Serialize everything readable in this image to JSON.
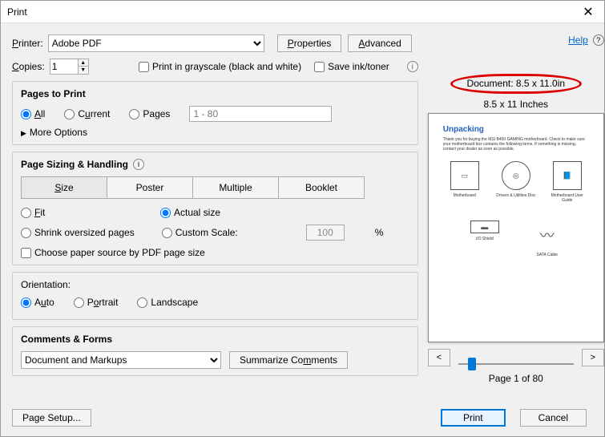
{
  "window": {
    "title": "Print"
  },
  "help": {
    "label": "Help"
  },
  "printer": {
    "label": "Printer:",
    "value": "Adobe PDF",
    "properties_btn": "Properties",
    "advanced_btn": "Advanced"
  },
  "copies": {
    "label": "Copies:",
    "value": "1"
  },
  "options": {
    "grayscale": "Print in grayscale (black and white)",
    "saveink": "Save ink/toner"
  },
  "pages": {
    "title": "Pages to Print",
    "all": "All",
    "current": "Current",
    "pages": "Pages",
    "range_placeholder": "1 - 80",
    "more": "More Options"
  },
  "handling": {
    "title": "Page Sizing & Handling",
    "tabs": {
      "size": "Size",
      "poster": "Poster",
      "multiple": "Multiple",
      "booklet": "Booklet"
    },
    "fit": "Fit",
    "actual": "Actual size",
    "shrink": "Shrink oversized pages",
    "custom": "Custom Scale:",
    "pct": "100",
    "pct_suffix": "%",
    "choose_paper": "Choose paper source by PDF page size"
  },
  "orientation": {
    "title": "Orientation:",
    "auto": "Auto",
    "portrait": "Portrait",
    "landscape": "Landscape"
  },
  "comments": {
    "title": "Comments & Forms",
    "value": "Document and Markups",
    "summarize": "Summarize Comments"
  },
  "preview": {
    "doc_size": "Document: 8.5 x 11.0in",
    "caption": "8.5 x 11 Inches",
    "heading": "Unpacking",
    "thumbs": [
      "Motherboard",
      "Drivers & Utilities Disc",
      "Motherboard User Guide",
      "I/O Shield",
      "SATA Cable"
    ],
    "prev": "<",
    "next": ">",
    "page_of": "Page 1 of 80"
  },
  "footer": {
    "page_setup": "Page Setup...",
    "print": "Print",
    "cancel": "Cancel"
  }
}
